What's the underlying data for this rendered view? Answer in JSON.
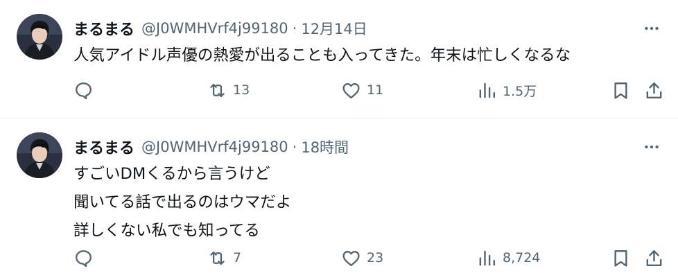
{
  "tweets": [
    {
      "name": "まるまる",
      "handle": "@J0WMHVrf4j99180",
      "dot": "·",
      "time": "12月14日",
      "lines": [
        "人気アイドル声優の熱愛が出ることも入ってきた。年末は忙しくなるな"
      ],
      "replies": "",
      "retweets": "13",
      "likes": "11",
      "views": "1.5万"
    },
    {
      "name": "まるまる",
      "handle": "@J0WMHVrf4j99180",
      "dot": "·",
      "time": "18時間",
      "lines": [
        "すごいDMくるから言うけど",
        "聞いてる話で出るのはウマだよ",
        "詳しくない私でも知ってる"
      ],
      "replies": "",
      "retweets": "7",
      "likes": "23",
      "views": "8,724"
    }
  ],
  "icons": {
    "more": "more-horizontal-icon",
    "reply": "reply-bubble-icon",
    "retweet": "retweet-icon",
    "like": "heart-icon",
    "views": "bar-chart-icon",
    "bookmark": "bookmark-icon",
    "share": "share-upload-icon"
  },
  "colors": {
    "text": "#0f1419",
    "secondary": "#536471",
    "divider": "#eff3f4"
  }
}
